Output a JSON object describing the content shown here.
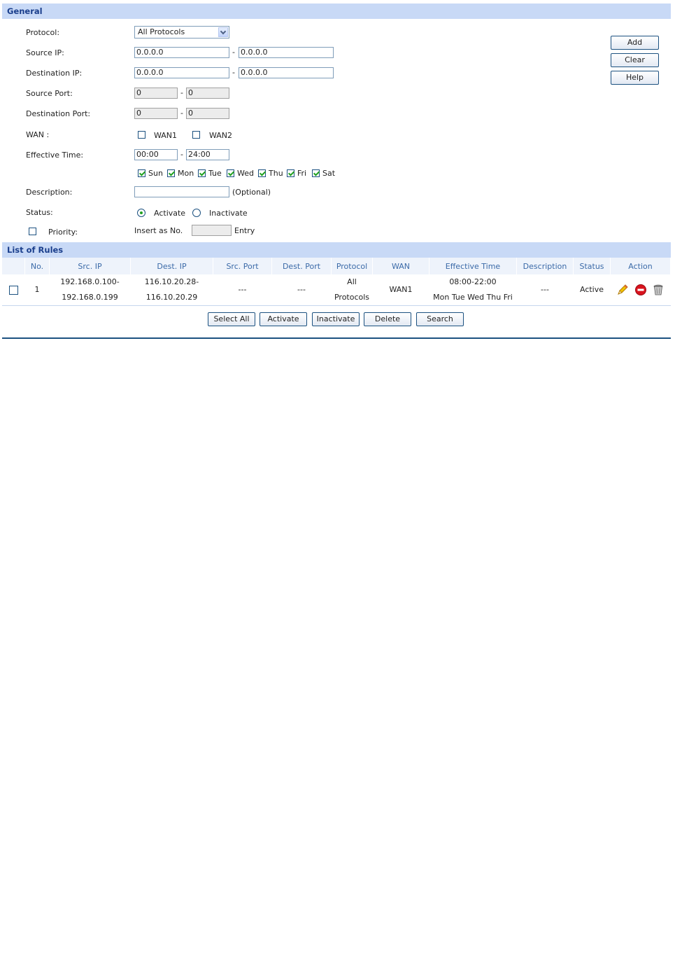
{
  "general": {
    "title": "General",
    "protocol_label": "Protocol:",
    "protocol_value": "All Protocols",
    "source_ip_label": "Source IP:",
    "source_ip_start": "0.0.0.0",
    "source_ip_end": "0.0.0.0",
    "dest_ip_label": "Destination IP:",
    "dest_ip_start": "0.0.0.0",
    "dest_ip_end": "0.0.0.0",
    "source_port_label": "Source Port:",
    "source_port_start": "0",
    "source_port_end": "0",
    "dest_port_label": "Destination Port:",
    "dest_port_start": "0",
    "dest_port_end": "0",
    "wan_label": "WAN :",
    "wan1": "WAN1",
    "wan2": "WAN2",
    "time_label": "Effective Time:",
    "time_start": "00:00",
    "time_end": "24:00",
    "days": [
      "Sun",
      "Mon",
      "Tue",
      "Wed",
      "Thu",
      "Fri",
      "Sat"
    ],
    "description_label": "Description:",
    "description_value": "",
    "optional": "(Optional)",
    "status_label": "Status:",
    "status_activate": "Activate",
    "status_inactivate": "Inactivate",
    "priority_label": "Priority:",
    "insert_as": "Insert as No.",
    "entry": "Entry",
    "dash": "-"
  },
  "side_buttons": {
    "add": "Add",
    "clear": "Clear",
    "help": "Help"
  },
  "rules": {
    "title": "List of Rules",
    "headers": [
      "No.",
      "Src. IP",
      "Dest. IP",
      "Src. Port",
      "Dest. Port",
      "Protocol",
      "WAN",
      "Effective Time",
      "Description",
      "Status",
      "Action"
    ],
    "rows": [
      {
        "no": "1",
        "src_ip_1": "192.168.0.100-",
        "src_ip_2": "192.168.0.199",
        "dest_ip_1": "116.10.20.28-",
        "dest_ip_2": "116.10.20.29",
        "src_port": "---",
        "dest_port": "---",
        "protocol_1": "All",
        "protocol_2": "Protocols",
        "wan": "WAN1",
        "time_1": "08:00-22:00",
        "time_2": "Mon Tue Wed Thu Fri",
        "description": "---",
        "status": "Active"
      }
    ]
  },
  "bottom_buttons": {
    "select_all": "Select All",
    "activate": "Activate",
    "inactivate": "Inactivate",
    "delete": "Delete",
    "search": "Search"
  },
  "colors": {
    "section_bar": "#c8d9f6",
    "section_text": "#1a3e8c",
    "header_text": "#3b6aa8",
    "rule_line": "#1c5180"
  }
}
